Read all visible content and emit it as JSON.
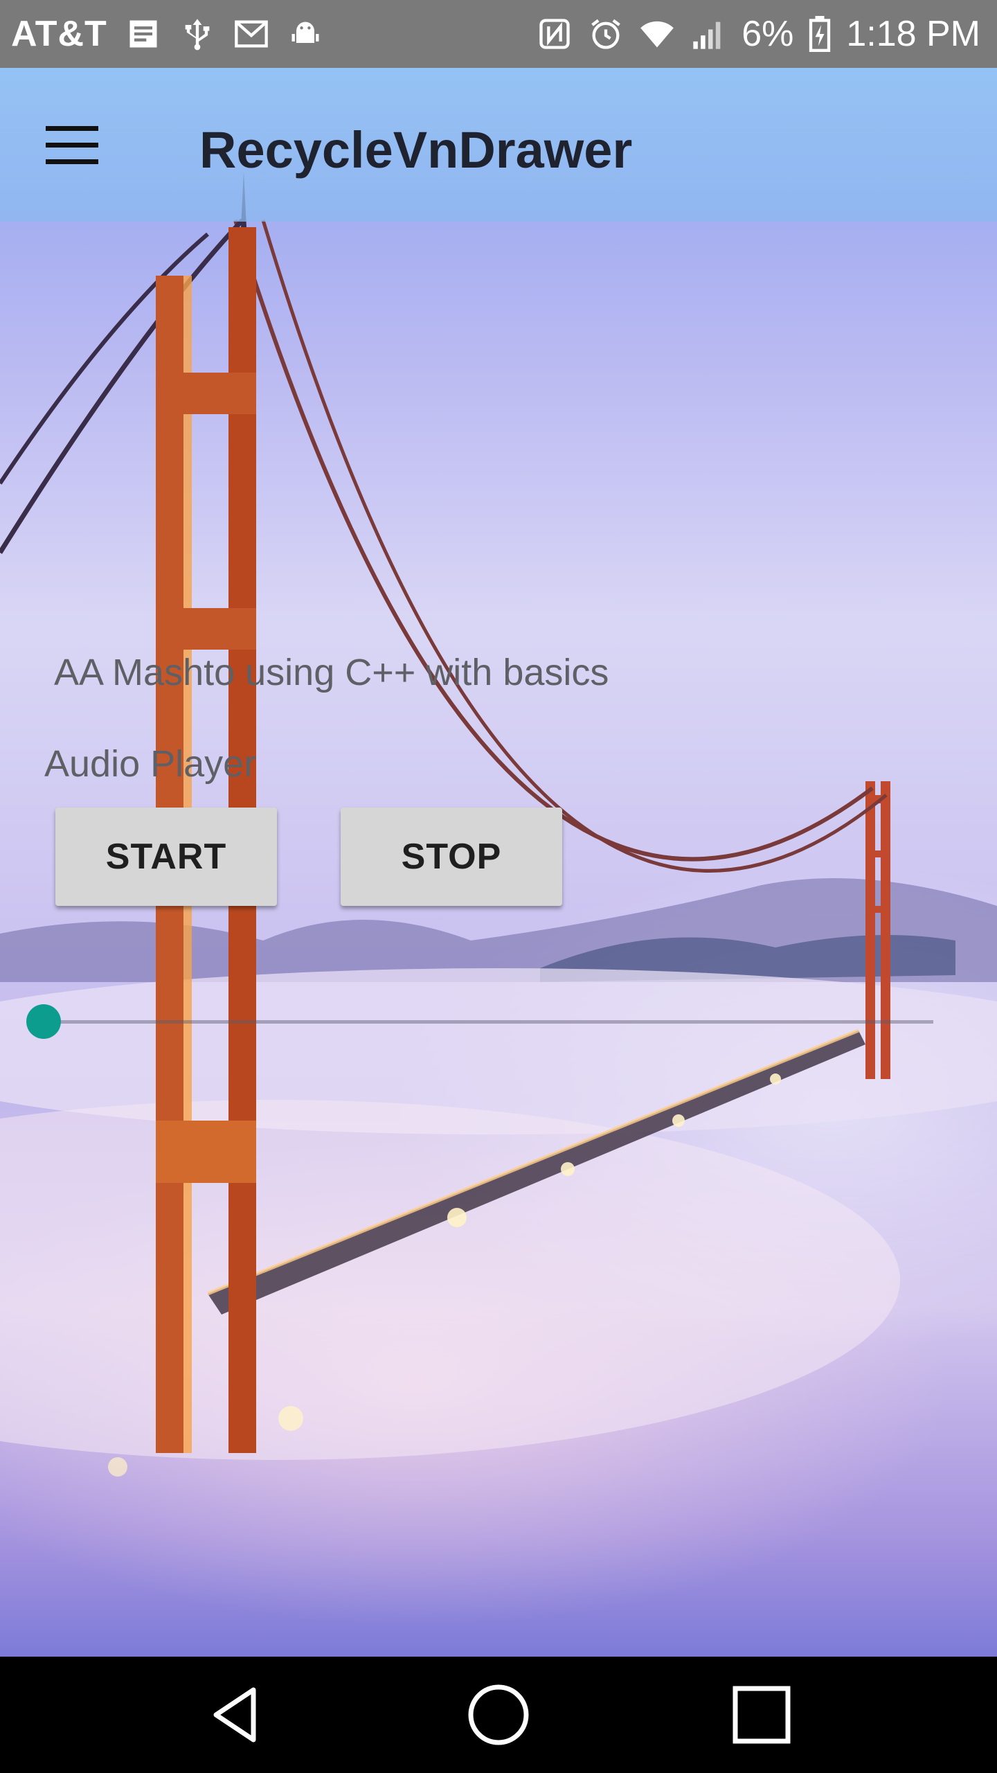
{
  "status_bar": {
    "carrier": "AT&T",
    "battery": "6%",
    "time": "1:18 PM",
    "left_icons": [
      "notes-icon",
      "usb-icon",
      "gmail-icon",
      "android-debug-icon"
    ],
    "right_icons": [
      "nfc-icon",
      "alarm-icon",
      "wifi-icon",
      "signal-icon",
      "battery-charging-icon"
    ]
  },
  "toolbar": {
    "title": "RecycleVnDrawer",
    "menu_icon": "hamburger-menu-icon"
  },
  "content": {
    "text1": "AA Mashto using C++ with basics",
    "text2": "Audio Player",
    "start_label": "START",
    "stop_label": "STOP",
    "seekbar_progress": 0
  },
  "nav_bar": {
    "icons": [
      "back-icon",
      "home-icon",
      "recents-icon"
    ]
  },
  "colors": {
    "accent": "#0d9d8f",
    "button_bg": "#d6d6d6",
    "status_bar": "#7a7a7a"
  }
}
